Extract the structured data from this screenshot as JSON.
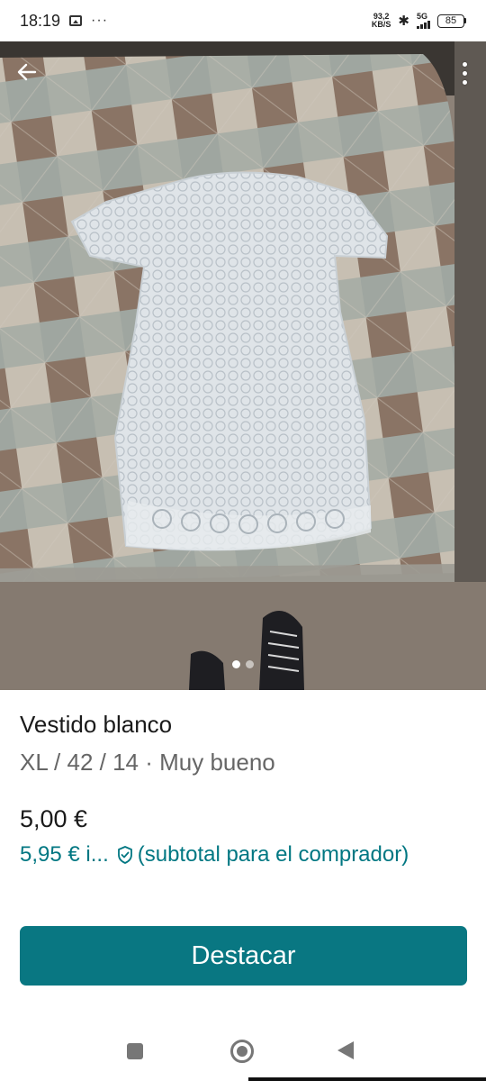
{
  "status_bar": {
    "time": "18:19",
    "menu_dots": "···",
    "net_speed_top": "93,2",
    "net_speed_bottom": "KB/S",
    "bluetooth": "✱",
    "network_type": "5G",
    "battery": "85",
    "icons": [
      "gallery-icon",
      "bluetooth-icon",
      "signal-icon",
      "battery-icon"
    ]
  },
  "photo": {
    "current_index": 1,
    "total": 2,
    "back_icon": "arrow-left-icon",
    "more_icon": "more-vertical-icon"
  },
  "item": {
    "title": "Vestido blanco",
    "details": "XL / 42 / 14 · Muy bueno",
    "price": "5,00 €",
    "buyer_price": "5,95 € i...",
    "buyer_price_note": "(subtotal para el comprador)"
  },
  "actions": {
    "primary_label": "Destacar"
  },
  "colors": {
    "accent": "#097782",
    "link": "#007782",
    "text": "#1a1a1a",
    "muted": "#666666"
  }
}
